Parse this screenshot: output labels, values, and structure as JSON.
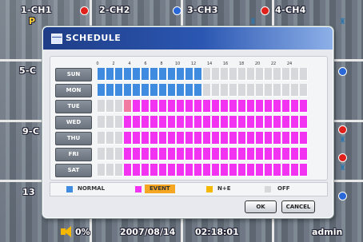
{
  "channels": [
    {
      "label": "1-CH1",
      "dot_color": ""
    },
    {
      "label": "2-CH2",
      "dot_color": "#e0201a"
    },
    {
      "label": "3-CH3",
      "dot_color": "#2a68d8"
    },
    {
      "label": "4-CH4",
      "dot_color": "#e0201a"
    },
    {
      "label": "5-C",
      "dot_color": ""
    },
    {
      "label": "9-C",
      "dot_color": ""
    },
    {
      "label": "13",
      "dot_color": ""
    }
  ],
  "channel_extra": {
    "p_label": "P"
  },
  "dialog": {
    "title": "SCHEDULE",
    "hours": [
      "0",
      "2",
      "4",
      "6",
      "8",
      "10",
      "12",
      "14",
      "16",
      "18",
      "20",
      "22",
      "24"
    ],
    "days": [
      "SUN",
      "MON",
      "TUE",
      "WED",
      "THU",
      "FRI",
      "SAT"
    ],
    "schedule": [
      "NNNNNNNNNNNNOOOOOOOOOOOO",
      "NNNNNNNNNNNNOOOOOOOOOOOO",
      "OOOEEEEEEEEEEEEEEEEEEEEE",
      "OOOEEEEEEEEEEEEEEEEEEEEE",
      "OOOEEEEEEEEEEEEEEEEEEEEE",
      "OOOEEEEEEEEEEEEEEEEEEEEE",
      "OOOEEEEEEEEEEEEEEEEEEEEE"
    ],
    "selected_cell": {
      "day": 2,
      "hour": 3
    },
    "colors": {
      "NORMAL": "#3f8be0",
      "EVENT": "#f233f2",
      "N+E": "#f5b800",
      "OFF": "#d6d8dc",
      "selected": "#f07aa0"
    },
    "legend": {
      "normal": "NORMAL",
      "event": "EVENT",
      "ne": "N+E",
      "off": "OFF"
    },
    "buttons": {
      "ok": "OK",
      "cancel": "CANCEL"
    }
  },
  "status": {
    "volume": "0%",
    "date": "2007/08/14",
    "time": "02:18:01",
    "user": "admin"
  }
}
